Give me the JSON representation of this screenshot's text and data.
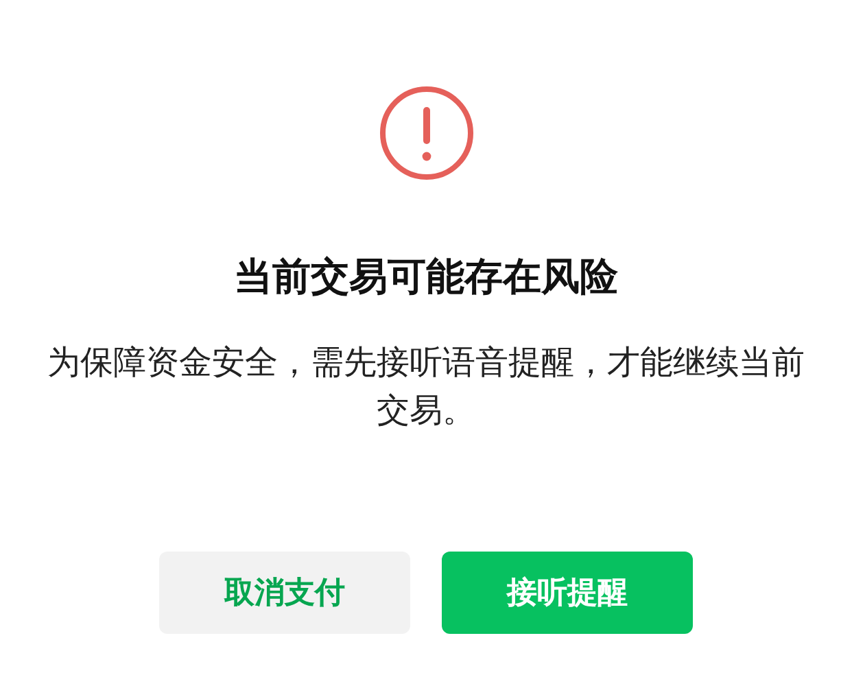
{
  "dialog": {
    "title": "当前交易可能存在风险",
    "message": "为保障资金安全，需先接听语音提醒，才能继续当前交易。",
    "buttons": [
      {
        "label": "取消支付",
        "kind": "secondary"
      },
      {
        "label": "接听提醒",
        "kind": "primary"
      }
    ]
  }
}
